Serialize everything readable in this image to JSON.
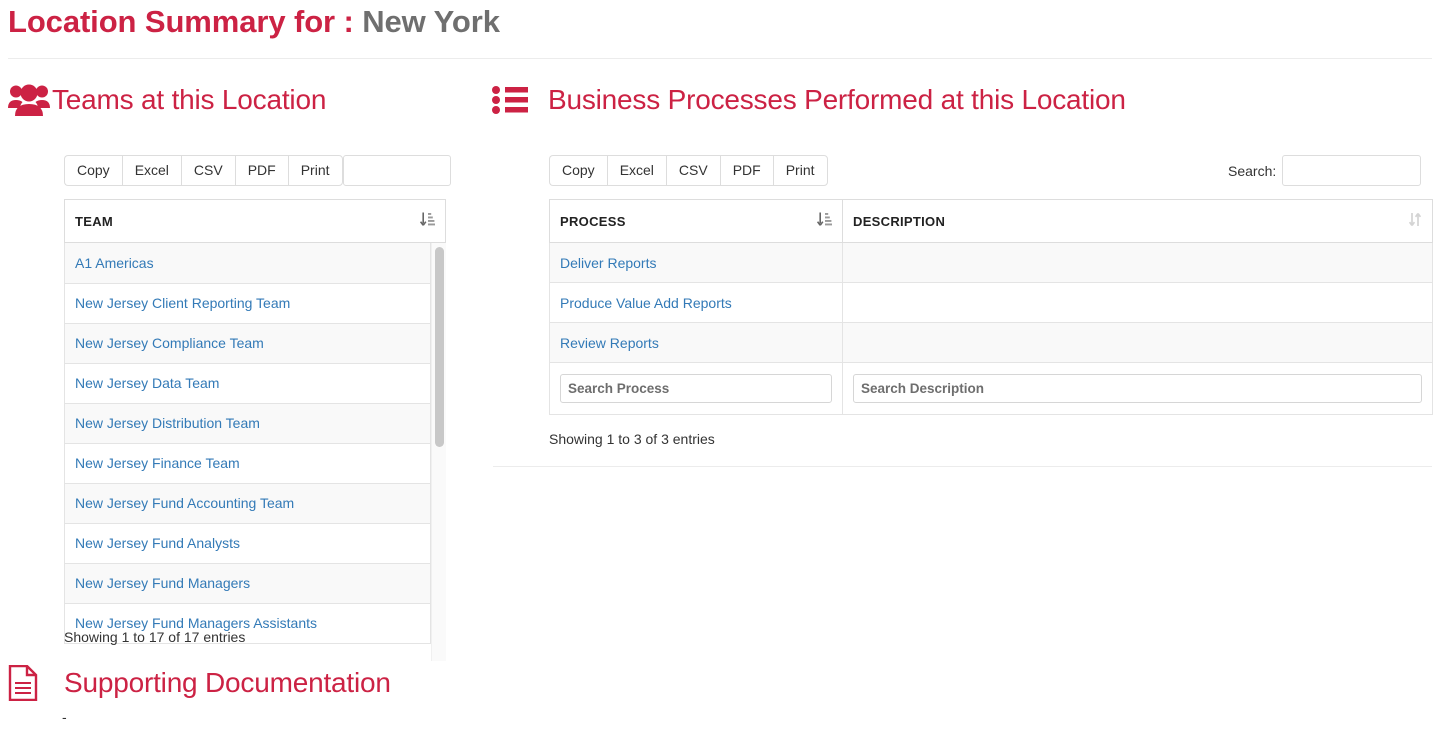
{
  "page": {
    "title_prefix": "Location Summary for :",
    "title_value": "New York",
    "accent_color": "#cc2244",
    "link_color": "#337ab7"
  },
  "teams_section": {
    "heading": "Teams at this Location",
    "icon": "users-icon",
    "buttons": [
      "Copy",
      "Excel",
      "CSV",
      "PDF",
      "Print"
    ],
    "search": {
      "label": "",
      "value": "",
      "placeholder": ""
    },
    "columns": [
      "TEAM"
    ],
    "sort": {
      "column": "TEAM",
      "direction": "descending",
      "icon": "sort-amount-desc-icon"
    },
    "rows": [
      "A1 Americas",
      "New Jersey Client Reporting Team",
      "New Jersey Compliance Team",
      "New Jersey Data Team",
      "New Jersey Distribution Team",
      "New Jersey Finance Team",
      "New Jersey Fund Accounting Team",
      "New Jersey Fund Analysts",
      "New Jersey Fund Managers",
      "New Jersey Fund Managers Assistants"
    ],
    "info": "Showing 1 to 17 of 17 entries"
  },
  "processes_section": {
    "heading": "Business Processes Performed at this Location",
    "icon": "list-ul-icon",
    "buttons": [
      "Copy",
      "Excel",
      "CSV",
      "PDF",
      "Print"
    ],
    "search": {
      "label": "Search:",
      "value": "",
      "placeholder": ""
    },
    "columns": [
      "PROCESS",
      "DESCRIPTION"
    ],
    "sort": {
      "column": "PROCESS",
      "direction": "descending",
      "icon": "sort-amount-desc-icon"
    },
    "unsorted_icon": "sort-both-icon",
    "rows": [
      {
        "process": "Deliver Reports",
        "description": ""
      },
      {
        "process": "Produce Value Add Reports",
        "description": ""
      },
      {
        "process": "Review Reports",
        "description": ""
      }
    ],
    "footer_filters": {
      "process_placeholder": "Search Process",
      "description_placeholder": "Search Description"
    },
    "info": "Showing 1 to 3 of 3 entries"
  },
  "documentation_section": {
    "heading": "Supporting Documentation",
    "icon": "file-text-icon",
    "content": "-"
  }
}
